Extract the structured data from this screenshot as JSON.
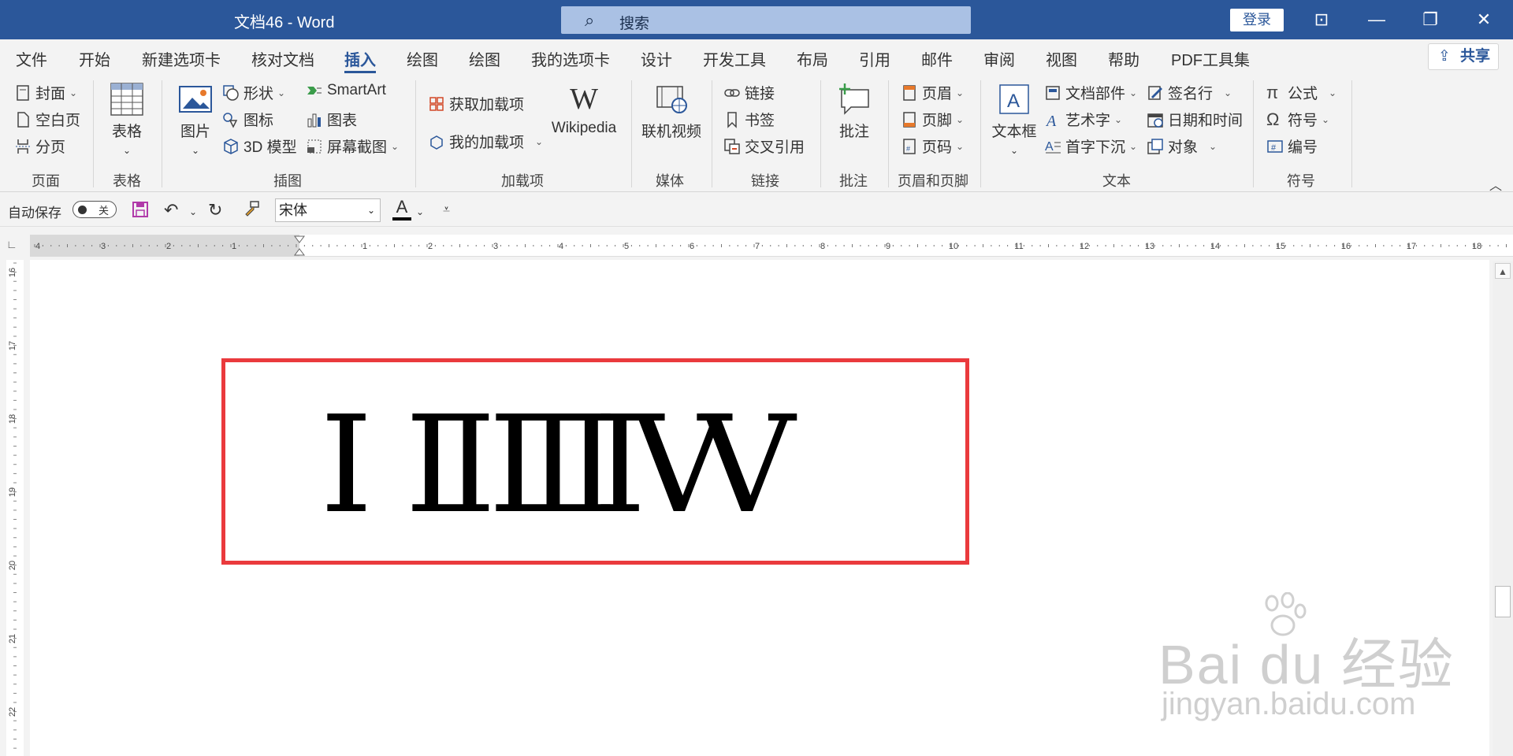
{
  "window": {
    "title": "文档46  -  Word",
    "search_placeholder": "搜索",
    "login_label": "登录",
    "controls": {
      "restore_ribbon": "⊡",
      "minimize": "—",
      "maximize": "❐",
      "close": "✕"
    }
  },
  "menu": {
    "tabs": [
      "文件",
      "开始",
      "新建选项卡",
      "核对文档",
      "插入",
      "绘图",
      "绘图",
      "我的选项卡",
      "设计",
      "开发工具",
      "布局",
      "引用",
      "邮件",
      "审阅",
      "视图",
      "帮助",
      "PDF工具集"
    ],
    "active_tab": "插入",
    "share_label": "共享"
  },
  "ribbon": {
    "pages": {
      "items": [
        "封面",
        "空白页",
        "分页"
      ],
      "label": "页面"
    },
    "table": {
      "button": "表格",
      "label": "表格"
    },
    "illustrations": {
      "picture": "图片",
      "shapes": "形状",
      "icons": "图标",
      "model3d": "3D 模型",
      "smartart": "SmartArt",
      "chart": "图表",
      "screenshot": "屏幕截图",
      "label": "插图"
    },
    "addins": {
      "get": "获取加载项",
      "my": "我的加载项",
      "wikipedia": "Wikipedia",
      "wikipedia_logo": "W",
      "label": "加载项"
    },
    "media": {
      "video": "联机视频",
      "label": "媒体"
    },
    "links": {
      "link": "链接",
      "bookmark": "书签",
      "crossref": "交叉引用",
      "label": "链接"
    },
    "comments": {
      "comment": "批注",
      "label": "批注"
    },
    "header_footer": {
      "header": "页眉",
      "footer": "页脚",
      "page_number": "页码",
      "label": "页眉和页脚"
    },
    "text": {
      "textbox": "文本框",
      "quick_parts": "文档部件",
      "wordart": "艺术字",
      "dropcap": "首字下沉",
      "signature": "签名行",
      "datetime": "日期和时间",
      "object": "对象",
      "label": "文本"
    },
    "symbols": {
      "equation": "公式",
      "symbol": "符号",
      "numbering": "编号",
      "label": "符号"
    }
  },
  "qat": {
    "autosave": "自动保存",
    "toggle_state": "关",
    "font": "宋体",
    "font_color_glyph": "A"
  },
  "ruler": {
    "left_numbers": [
      "4",
      "3",
      "2",
      "1"
    ],
    "right_numbers": [
      "1",
      "2",
      "3",
      "4",
      "5",
      "6",
      "7",
      "8",
      "9",
      "10",
      "11",
      "12",
      "13",
      "14",
      "15",
      "16",
      "17",
      "18"
    ],
    "vertical_numbers": [
      "16",
      "17",
      "18",
      "19",
      "20",
      "21",
      "22"
    ]
  },
  "document": {
    "numerals": [
      "Ⅰ",
      "Ⅱ",
      "Ⅲ",
      "Ⅳ",
      "Ⅴ"
    ],
    "frame_color": "#ea3a3d"
  },
  "watermark": {
    "brand": "Bai du 经验",
    "url": "jingyan.baidu.com"
  },
  "colors": {
    "accent": "#2b579a",
    "search_bg": "#aac1e4"
  }
}
